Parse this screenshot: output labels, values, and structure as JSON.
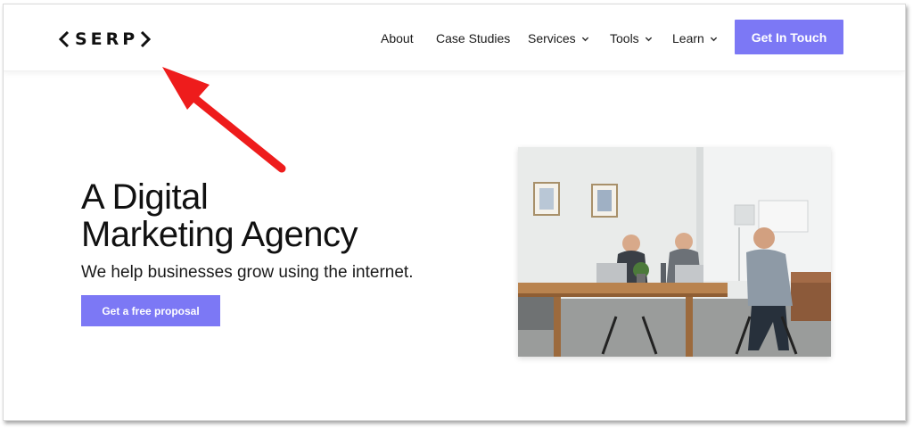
{
  "brand": {
    "logo_text": "SERP",
    "accent_color": "#7c78f5"
  },
  "nav": {
    "items": [
      {
        "label": "About",
        "has_dropdown": false
      },
      {
        "label": "Case Studies",
        "has_dropdown": false
      },
      {
        "label": "Services",
        "has_dropdown": true
      },
      {
        "label": "Tools",
        "has_dropdown": true
      },
      {
        "label": "Learn",
        "has_dropdown": true
      }
    ],
    "cta_label": "Get In Touch"
  },
  "hero": {
    "title_line1": "A Digital",
    "title_line2": "Marketing Agency",
    "subtitle": "We help businesses grow using the internet.",
    "button_label": "Get a free proposal"
  },
  "annotation": {
    "type": "red-arrow",
    "color": "#ee1c1c",
    "points_to": "logo"
  }
}
